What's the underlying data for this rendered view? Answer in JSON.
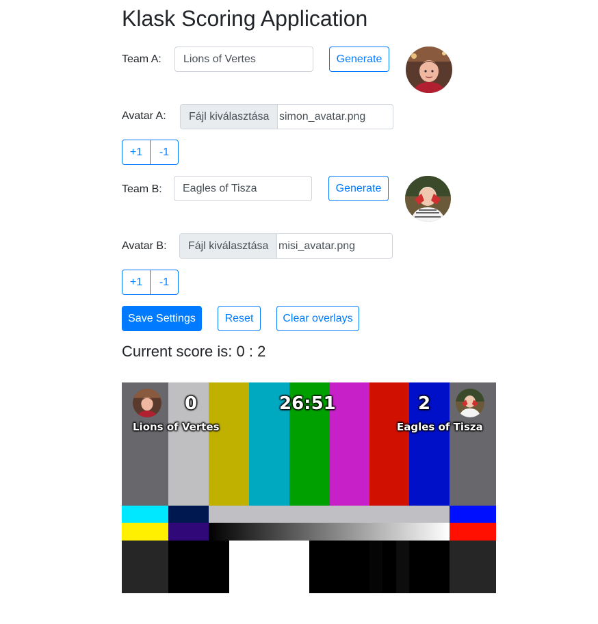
{
  "page": {
    "title": "Klask Scoring Application"
  },
  "team_a": {
    "label": "Team A:",
    "name": "Lions of Vertes",
    "generate_label": "Generate",
    "avatar_label": "Avatar A:",
    "file_button": "Fájl kiválasztása",
    "file_name": "simon_avatar.png",
    "plus_label": "+1",
    "minus_label": "-1"
  },
  "team_b": {
    "label": "Team B:",
    "name": "Eagles of Tisza",
    "generate_label": "Generate",
    "avatar_label": "Avatar B:",
    "file_button": "Fájl kiválasztása",
    "file_name": "misi_avatar.png",
    "plus_label": "+1",
    "minus_label": "-1"
  },
  "actions": {
    "save_label": "Save Settings",
    "reset_label": "Reset",
    "clear_label": "Clear overlays"
  },
  "score": {
    "text": "Current score is: 0 : 2"
  },
  "overlay": {
    "score_a": "0",
    "score_b": "2",
    "timer": "26:51",
    "name_a": "Lions of Vertes",
    "name_b": "Eagles of Tisza"
  },
  "colors": {
    "primary": "#007bff",
    "text": "#212529"
  }
}
